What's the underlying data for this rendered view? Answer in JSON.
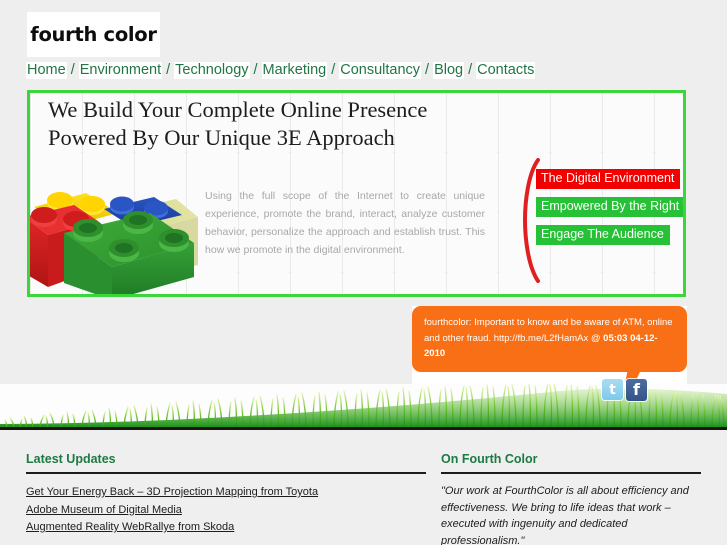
{
  "brand": {
    "logo_text": "fourth color"
  },
  "nav": {
    "separator": "/",
    "items": [
      {
        "label": "Home"
      },
      {
        "label": "Environment"
      },
      {
        "label": "Technology"
      },
      {
        "label": "Marketing"
      },
      {
        "label": "Consultancy"
      },
      {
        "label": "Blog"
      },
      {
        "label": "Contacts"
      }
    ]
  },
  "hero": {
    "headline_line1": "We Build Your Complete Online Presence",
    "headline_line2": "Powered By Our Unique 3E Approach",
    "paragraph": "Using the full scope of the Internet to create unique experience, promote the brand, interact, analyze customer behavior, personalize the approach and establish trust. This how we promote in the digital environment.",
    "image_name": "lego-bricks-photo",
    "badges": [
      {
        "label": "The Digital Environment",
        "color": "#f20000"
      },
      {
        "label": "Empowered By the Right Technology",
        "color": "#27c137"
      },
      {
        "label": "Engage The Audience",
        "color": "#27c137"
      }
    ],
    "border_color": "#3bd63b",
    "brace_color": "#e02020"
  },
  "tweet": {
    "text_part1": "fourthcolor: Important to know and be aware of ATM, online and other fraud. http://fb.me/L2fHamAx @ ",
    "timestamp": "05:03 04-12-2010",
    "background": "#f96f15"
  },
  "social": {
    "items": [
      {
        "name": "twitter-icon",
        "glyph": "t"
      },
      {
        "name": "facebook-icon",
        "glyph": "f"
      }
    ]
  },
  "footer": {
    "left": {
      "title": "Latest Updates",
      "links": [
        {
          "label": "Get Your Energy Back – 3D Projection Mapping from Toyota"
        },
        {
          "label": "Adobe Museum of Digital Media"
        },
        {
          "label": "Augmented Reality WebRallye from Skoda"
        }
      ]
    },
    "right": {
      "title": "On Fourth Color",
      "quote": "\"Our work at FourthColor is all about efficiency and effectiveness. We bring to life ideas that work – executed with ingenuity and dedicated professionalism.\""
    }
  }
}
